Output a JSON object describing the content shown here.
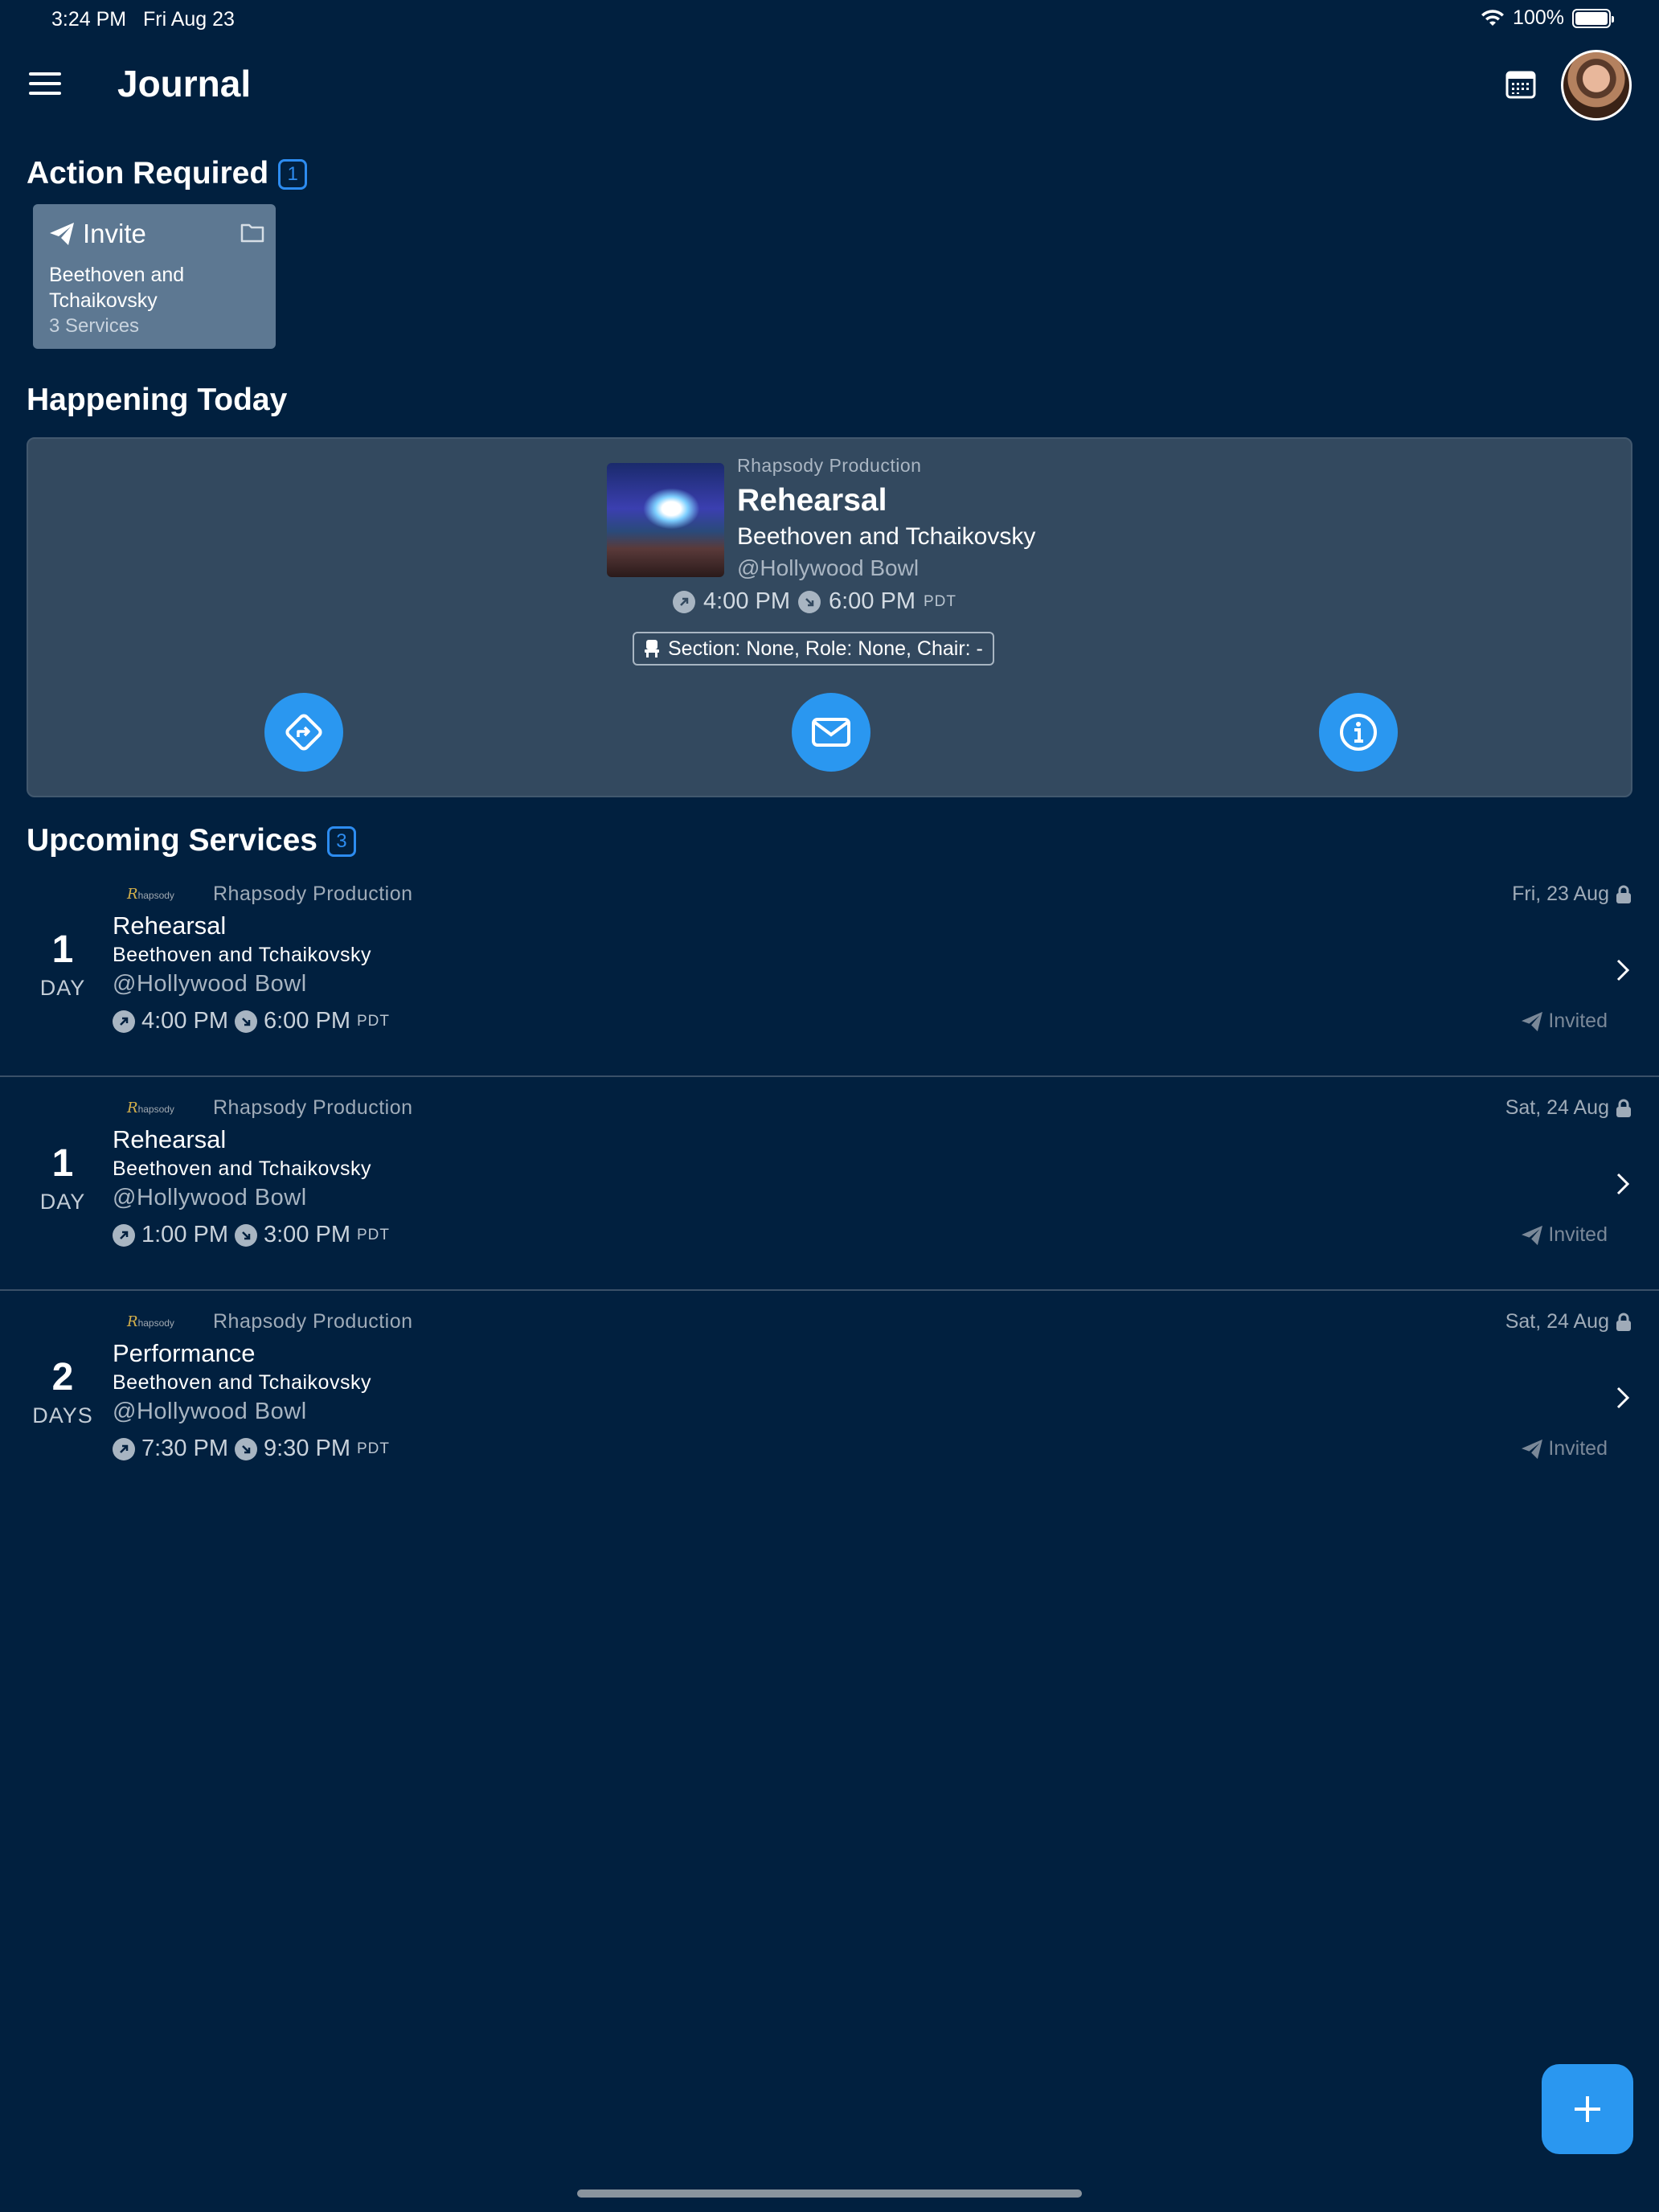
{
  "status_bar": {
    "time": "3:24 PM",
    "date": "Fri Aug 23",
    "battery": "100%"
  },
  "header": {
    "title": "Journal",
    "menu_icon": "hamburger-menu-icon",
    "calendar_icon": "calendar-icon"
  },
  "action_required": {
    "title": "Action Required",
    "count": "1",
    "card": {
      "type": "Invite",
      "program": "Beethoven and Tchaikovsky",
      "services": "3 Services"
    }
  },
  "happening_today": {
    "title": "Happening Today",
    "org": "Rhapsody Production",
    "event": "Rehearsal",
    "program": "Beethoven and Tchaikovsky",
    "venue": "@Hollywood Bowl",
    "start": "4:00 PM",
    "end": "6:00 PM",
    "tz": "PDT",
    "assignment": "Section: None, Role: None, Chair: -",
    "actions": [
      "directions-icon",
      "mail-icon",
      "info-icon"
    ]
  },
  "upcoming": {
    "title": "Upcoming Services",
    "count": "3",
    "items": [
      {
        "org": "Rhapsody Production",
        "date": "Fri, 23 Aug",
        "count": "1",
        "unit": "DAY",
        "event": "Rehearsal",
        "program": "Beethoven and Tchaikovsky",
        "venue": "@Hollywood Bowl",
        "start": "4:00 PM",
        "end": "6:00 PM",
        "tz": "PDT",
        "status": "Invited"
      },
      {
        "org": "Rhapsody Production",
        "date": "Sat, 24 Aug",
        "count": "1",
        "unit": "DAY",
        "event": "Rehearsal",
        "program": "Beethoven and Tchaikovsky",
        "venue": "@Hollywood Bowl",
        "start": "1:00 PM",
        "end": "3:00 PM",
        "tz": "PDT",
        "status": "Invited"
      },
      {
        "org": "Rhapsody Production",
        "date": "Sat, 24 Aug",
        "count": "2",
        "unit": "DAYS",
        "event": "Performance",
        "program": "Beethoven and Tchaikovsky",
        "venue": "@Hollywood Bowl",
        "start": "7:30 PM",
        "end": "9:30 PM",
        "tz": "PDT",
        "status": "Invited"
      }
    ]
  },
  "logo_text": {
    "mark": "R",
    "word": "hapsody"
  },
  "colors": {
    "background": "#01203f",
    "accent": "#2a97f0",
    "card": "#33495f",
    "invite_card": "#5d7892"
  }
}
